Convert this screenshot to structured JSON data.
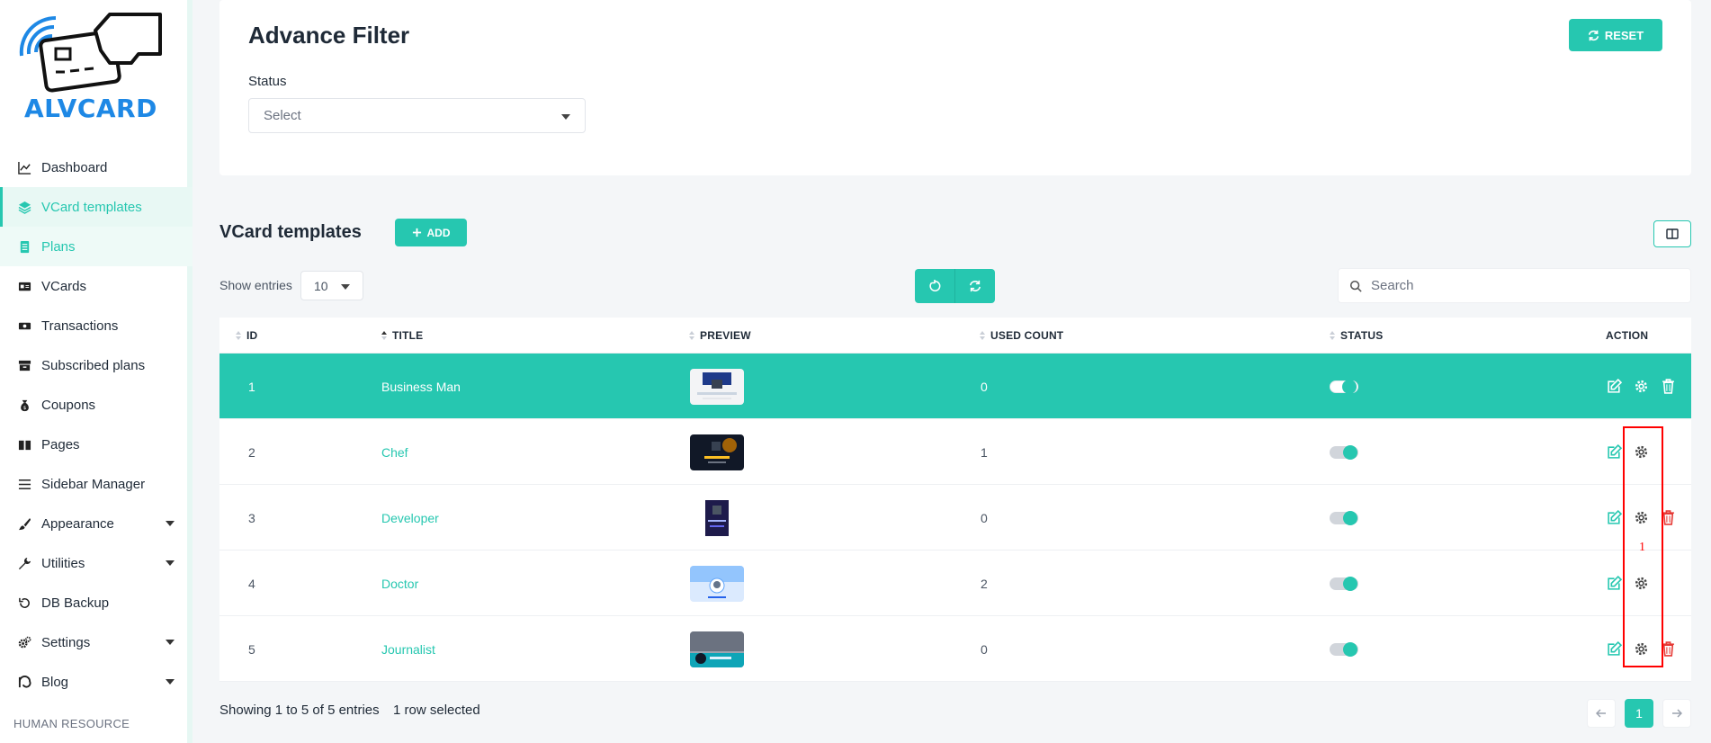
{
  "brand": {
    "name": "ALVCARD"
  },
  "sidebar": {
    "items": [
      {
        "label": "Dashboard",
        "icon": "chart-line-icon"
      },
      {
        "label": "VCard templates",
        "icon": "layers-icon"
      },
      {
        "label": "Plans",
        "icon": "document-icon"
      },
      {
        "label": "VCards",
        "icon": "id-card-icon"
      },
      {
        "label": "Transactions",
        "icon": "money-icon"
      },
      {
        "label": "Subscribed plans",
        "icon": "archive-icon"
      },
      {
        "label": "Coupons",
        "icon": "money-bag-icon"
      },
      {
        "label": "Pages",
        "icon": "book-icon"
      },
      {
        "label": "Sidebar Manager",
        "icon": "list-icon"
      },
      {
        "label": "Appearance",
        "icon": "brush-icon"
      },
      {
        "label": "Utilities",
        "icon": "wrench-icon"
      },
      {
        "label": "DB Backup",
        "icon": "history-icon"
      },
      {
        "label": "Settings",
        "icon": "cogs-icon"
      },
      {
        "label": "Blog",
        "icon": "blog-icon"
      }
    ],
    "section": "HUMAN RESOURCE"
  },
  "filter": {
    "title": "Advance Filter",
    "reset_label": "RESET",
    "status_label": "Status",
    "status_value": "Select"
  },
  "templates": {
    "title": "VCard templates",
    "add_label": "ADD",
    "show_entries_label": "Show entries",
    "entries_value": "10",
    "search_placeholder": "Search",
    "columns": [
      "ID",
      "TITLE",
      "PREVIEW",
      "USED COUNT",
      "STATUS",
      "ACTION"
    ],
    "rows": [
      {
        "id": "1",
        "title": "Business Man",
        "used": "0"
      },
      {
        "id": "2",
        "title": "Chef",
        "used": "1"
      },
      {
        "id": "3",
        "title": "Developer",
        "used": "0"
      },
      {
        "id": "4",
        "title": "Doctor",
        "used": "2"
      },
      {
        "id": "5",
        "title": "Journalist",
        "used": "0"
      }
    ],
    "showing_text": "Showing 1 to 5 of 5 entries",
    "selected_text": "1 row selected",
    "current_page": "1"
  },
  "annotation": {
    "label": "1",
    "color": "#ff0000"
  },
  "colors": {
    "accent": "#26c7b0",
    "danger": "#e53935",
    "brand_blue": "#1e88e5"
  }
}
